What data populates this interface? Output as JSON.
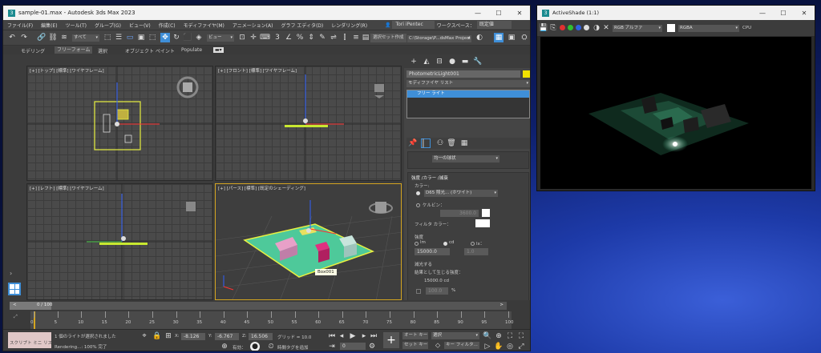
{
  "main_window": {
    "title": "sample-01.max - Autodesk 3ds Max 2023",
    "controls": [
      "—",
      "☐",
      "✕"
    ],
    "menu": [
      "ファイル(F)",
      "編集(E)",
      "ツール(T)",
      "グループ(G)",
      "ビュー(V)",
      "作成(C)",
      "モディファイヤ(M)",
      "アニメーション(A)",
      "グラフ エディタ(D)",
      "レンダリング(R)"
    ],
    "user": "Tori iPentec",
    "workspace_label": "ワークスペース：",
    "workspace_value": "既定値",
    "toolbar": {
      "selection_filter": "すべて",
      "view_dropdown": "ビュー",
      "selection_set": "選択セット作成",
      "project_path": "C:\\Storage\\P...dsMax Project"
    },
    "ribbon_tabs": [
      "モデリング",
      "フリーフォーム",
      "選択",
      "オブジェクト ペイント",
      "Populate"
    ]
  },
  "viewports": {
    "top": "[+] [トップ] [標準] [ワイヤフレーム]",
    "front": "[+] [フロント] [標準] [ワイヤフレーム]",
    "left": "[+] [レフト] [標準] [ワイヤフレーム]",
    "persp": "[+] [パース] [標準] [既定のシェーディング]",
    "persp_tooltip": "Box001"
  },
  "command_panel": {
    "object_name": "PhotometricLight001",
    "modifier_list": "モディファイヤ リスト",
    "stack_item": "フリー ライト",
    "distribution_dropdown": "均一の球状",
    "rollout_title": "強度 /カラー /減衰",
    "color_label": "カラー:",
    "color_preset": "D65 照光... (ホワイト)",
    "kelvin_label": "ケルビン：",
    "kelvin_value": "3600.0",
    "filter_color_label": "フィルタ カラー：",
    "intensity_label": "強度",
    "units": [
      "lm",
      "cd",
      "lx："
    ],
    "intensity_value": "15000.0",
    "lx_value": "1.0",
    "dimming_label": "減光する",
    "result_label": "結果として生じる強度：",
    "result_value": "15000.0 cd",
    "percent_value": "100.0",
    "percent_unit": "%"
  },
  "timeline": {
    "frame_label": "0 / 100",
    "ticks": [
      "0",
      "5",
      "10",
      "15",
      "20",
      "25",
      "30",
      "35",
      "40",
      "45",
      "50",
      "55",
      "60",
      "65",
      "70",
      "75",
      "80",
      "85",
      "90",
      "95",
      "100"
    ]
  },
  "status": {
    "script_label": "スクリプト ミニ リスナ",
    "selection_msg": "1 個のライトが選択されました",
    "render_msg": "Rendering...: 100% 完了",
    "x_label": "X:",
    "x_value": "-8.126",
    "y_label": "Y:",
    "y_value": "-6.767",
    "z_label": "Z:",
    "z_value": "16.506",
    "grid_label": "グリッド = 10.0",
    "enabled_label": "有効：",
    "add_time_tag": "時間タグを追加",
    "auto_key": "オート キー",
    "set_key": "セット キー",
    "selected": "選択",
    "key_filter": "キー フィルタ...",
    "frame_value": "0"
  },
  "activeshade": {
    "title": "ActiveShade (1:1)",
    "controls": [
      "—",
      "☐",
      "✕"
    ],
    "alpha_dropdown": "RGB アルファ",
    "channel_dropdown": "RGBA",
    "cpu_label": "CPU"
  },
  "colors": {
    "swatch_yellow": "#f2e100",
    "light_line": "#c8e830",
    "floor_green": "#4ec99a",
    "accent_blue": "#3f8fd8",
    "selected_wire": "#e8f040"
  }
}
